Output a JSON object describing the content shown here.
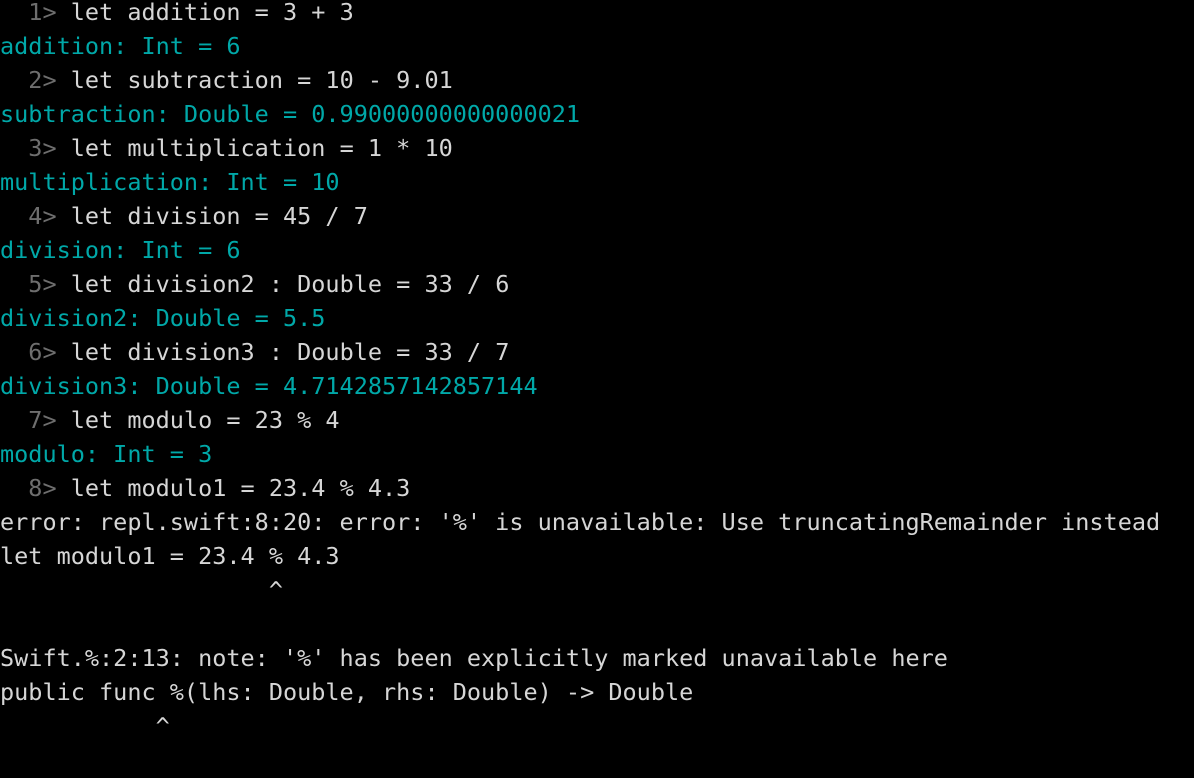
{
  "terminal": {
    "app": "Swift REPL",
    "background_color": "#000000",
    "colors": {
      "prompt": "#6e6e6e",
      "code": "#d6d6d6",
      "result": "#00a8a8",
      "error": "#d6d6d6",
      "note": "#d6d6d6",
      "caret": "#d6d6d6"
    },
    "lines": [
      {
        "role": "prompt-line",
        "prompt": "  1> ",
        "text": "let addition = 3 + 3"
      },
      {
        "role": "result-line",
        "prompt": "",
        "text": "addition: Int = 6"
      },
      {
        "role": "prompt-line",
        "prompt": "  2> ",
        "text": "let subtraction = 10 - 9.01"
      },
      {
        "role": "result-line",
        "prompt": "",
        "text": "subtraction: Double = 0.99000000000000021"
      },
      {
        "role": "prompt-line",
        "prompt": "  3> ",
        "text": "let multiplication = 1 * 10"
      },
      {
        "role": "result-line",
        "prompt": "",
        "text": "multiplication: Int = 10"
      },
      {
        "role": "prompt-line",
        "prompt": "  4> ",
        "text": "let division = 45 / 7"
      },
      {
        "role": "result-line",
        "prompt": "",
        "text": "division: Int = 6"
      },
      {
        "role": "prompt-line",
        "prompt": "  5> ",
        "text": "let division2 : Double = 33 / 6"
      },
      {
        "role": "result-line",
        "prompt": "",
        "text": "division2: Double = 5.5"
      },
      {
        "role": "prompt-line",
        "prompt": "  6> ",
        "text": "let division3 : Double = 33 / 7"
      },
      {
        "role": "result-line",
        "prompt": "",
        "text": "division3: Double = 4.7142857142857144"
      },
      {
        "role": "prompt-line",
        "prompt": "  7> ",
        "text": "let modulo = 23 % 4"
      },
      {
        "role": "result-line",
        "prompt": "",
        "text": "modulo: Int = 3"
      },
      {
        "role": "prompt-line",
        "prompt": "  8> ",
        "text": "let modulo1 = 23.4 % 4.3"
      },
      {
        "role": "error-line",
        "prompt": "",
        "text": "error: repl.swift:8:20: error: '%' is unavailable: Use truncatingRemainder instead"
      },
      {
        "role": "error-line",
        "prompt": "",
        "text": "let modulo1 = 23.4 % 4.3"
      },
      {
        "role": "caret-line",
        "prompt": "",
        "text": "                   ^"
      },
      {
        "role": "blank-line",
        "prompt": "",
        "text": ""
      },
      {
        "role": "note-line",
        "prompt": "",
        "text": "Swift.%:2:13: note: '%' has been explicitly marked unavailable here"
      },
      {
        "role": "note-line",
        "prompt": "",
        "text": "public func %(lhs: Double, rhs: Double) -> Double"
      },
      {
        "role": "caret-line",
        "prompt": "",
        "text": "           ^"
      }
    ]
  }
}
